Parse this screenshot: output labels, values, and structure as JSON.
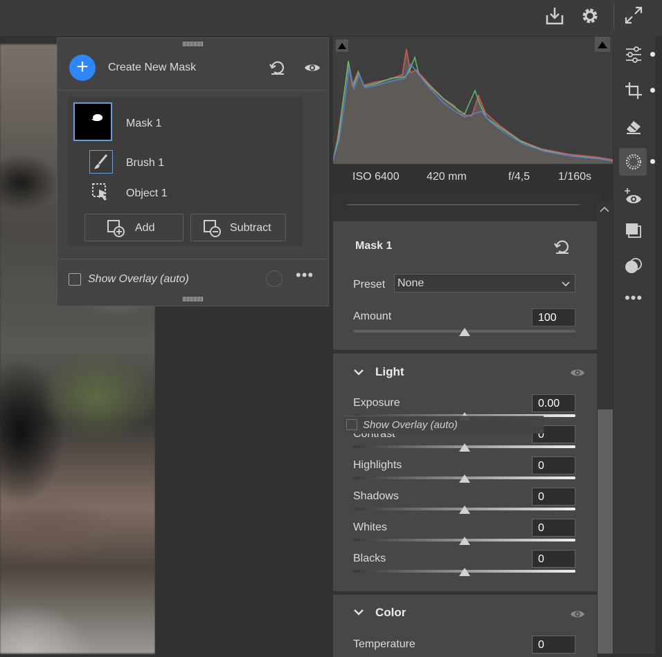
{
  "topbar": {
    "download_icon": "download-icon",
    "settings_icon": "gear-icon",
    "fullscreen_icon": "expand-icon"
  },
  "mask_panel": {
    "create_label": "Create New Mask",
    "masks": [
      {
        "name": "Mask 1",
        "components": [
          "Brush 1",
          "Object 1"
        ]
      }
    ],
    "add_label": "Add",
    "subtract_label": "Subtract",
    "overlay_label": "Show Overlay (auto)"
  },
  "exif": {
    "iso": "ISO 6400",
    "focal": "420 mm",
    "aperture": "f/4,5",
    "shutter": "1/160s"
  },
  "mask_settings": {
    "title": "Mask 1",
    "preset_label": "Preset",
    "preset_value": "None",
    "amount_label": "Amount",
    "amount_value": "100",
    "amount_level": 0.5
  },
  "light": {
    "title": "Light",
    "sliders": [
      {
        "label": "Exposure",
        "value": "0.00",
        "level": 0.5
      },
      {
        "label": "Contrast",
        "value": "0",
        "level": 0.5
      },
      {
        "label": "Highlights",
        "value": "0",
        "level": 0.5
      },
      {
        "label": "Shadows",
        "value": "0",
        "level": 0.5
      },
      {
        "label": "Whites",
        "value": "0",
        "level": 0.5
      },
      {
        "label": "Blacks",
        "value": "0",
        "level": 0.5
      }
    ]
  },
  "color": {
    "title": "Color",
    "sliders": [
      {
        "label": "Temperature",
        "value": "0"
      }
    ]
  },
  "drag_ghost": {
    "label": "Show Overlay (auto)"
  },
  "toolstrip": [
    "edit-sliders-icon",
    "crop-icon",
    "eraser-icon",
    "mask-icon",
    "redeye-icon",
    "snapshots-icon",
    "presets-icon",
    "more-icon"
  ],
  "colors": {
    "accent": "#2f86f6",
    "panel": "#474747",
    "background": "#323232"
  }
}
